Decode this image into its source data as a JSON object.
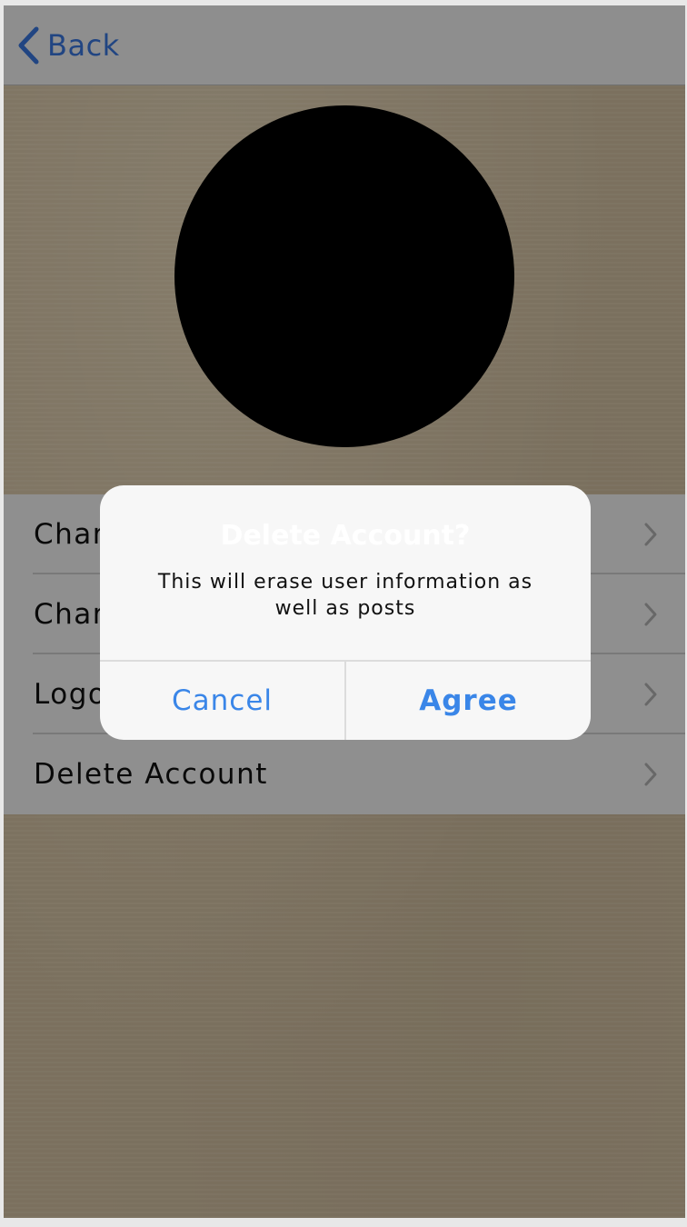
{
  "navbar": {
    "back_label": "Back",
    "back_icon": "chevron-left-icon"
  },
  "settings": {
    "items": [
      {
        "label": "Change Password"
      },
      {
        "label": "Change Username"
      },
      {
        "label": "Logout"
      },
      {
        "label": "Delete Account"
      }
    ],
    "chevron_icon": "chevron-right-icon"
  },
  "dialog": {
    "title": "Delete Account?",
    "message": "This will erase user information as well as posts",
    "cancel_label": "Cancel",
    "agree_label": "Agree"
  },
  "colors": {
    "accent": "#3a86e8",
    "overlay": "rgba(0,0,0,0.42)",
    "dialog_bg": "#f7f7f7"
  }
}
